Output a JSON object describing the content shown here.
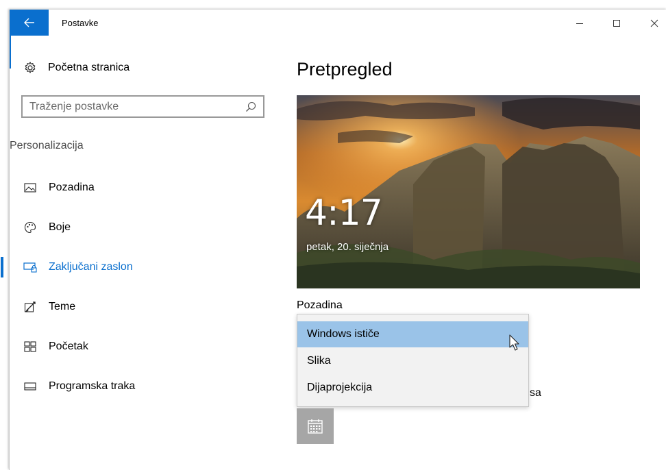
{
  "window": {
    "title": "Postavke",
    "back_icon": "arrow-left-icon",
    "controls": [
      "minimize-icon",
      "maximize-icon",
      "close-icon"
    ]
  },
  "sidebar": {
    "home_label": "Početna stranica",
    "search_placeholder": "Traženje postavke",
    "section_title": "Personalizacija",
    "items": [
      {
        "label": "Pozadina",
        "icon": "picture-icon",
        "active": false
      },
      {
        "label": "Boje",
        "icon": "palette-icon",
        "active": false
      },
      {
        "label": "Zaključani zaslon",
        "icon": "lock-screen-icon",
        "active": true
      },
      {
        "label": "Teme",
        "icon": "themes-icon",
        "active": false
      },
      {
        "label": "Početak",
        "icon": "start-icon",
        "active": false
      },
      {
        "label": "Programska traka",
        "icon": "taskbar-icon",
        "active": false
      }
    ]
  },
  "main": {
    "title": "Pretpregled",
    "preview": {
      "time": "4:17",
      "date": "petak, 20. siječnja"
    },
    "background_label": "Pozadina",
    "dropdown": {
      "options": [
        "Windows ističe",
        "Slika",
        "Dijaprojekcija"
      ],
      "selected_index": 0
    },
    "obscured_text": "sa",
    "calendar_icon": "calendar-icon"
  },
  "colors": {
    "accent": "#0a6fce",
    "selected_option": "#9ac3e8",
    "dropdown_bg": "#f2f2f2",
    "tile_bg": "#a6a6a6"
  }
}
